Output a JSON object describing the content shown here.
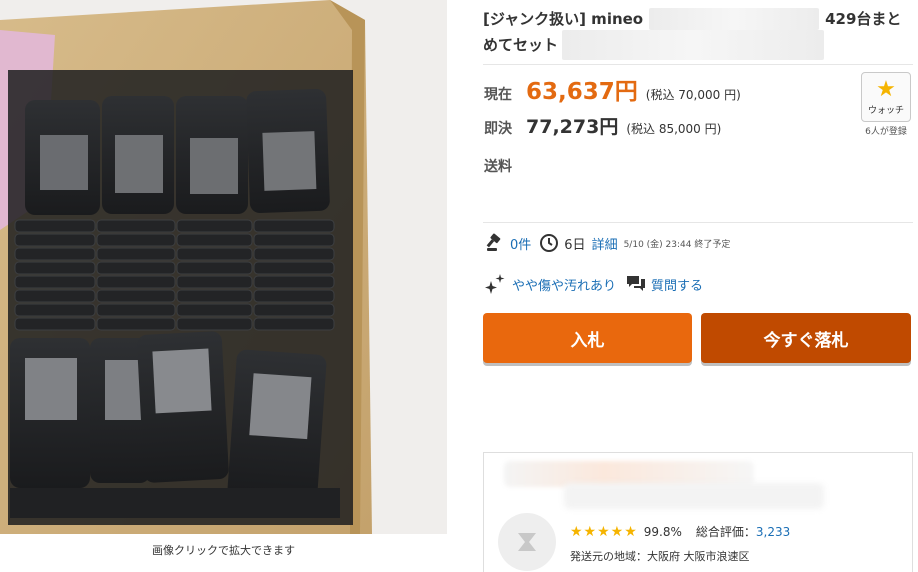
{
  "image": {
    "caption": "画像クリックで拡大できます"
  },
  "title": {
    "line1_prefix": "[ジャンク扱い] mineo",
    "line1_suffix": "429台まと",
    "line2": "めてセット"
  },
  "price": {
    "current_label": "現在",
    "current_value": "63,637円",
    "current_tax": "(税込 70,000 円)",
    "buynow_label": "即決",
    "buynow_value": "77,273円",
    "buynow_tax": "(税込 85,000 円)"
  },
  "shipping_label": "送料",
  "watch": {
    "label": "ウォッチ",
    "count": "6人が登録",
    "icon": "star-icon"
  },
  "meta": {
    "bids": "0件",
    "time_left": "6日",
    "detail_link": "詳細",
    "end_time": "5/10 (金) 23:44 終了予定",
    "condition": "やや傷や汚れあり",
    "question": "質問する"
  },
  "buttons": {
    "bid": "入札",
    "buy_now": "今すぐ落札"
  },
  "seller": {
    "positive_rate": "99.8%",
    "rating_label": "総合評価：",
    "rating_value": "3,233",
    "location": "発送元の地域：大阪府 大阪市浪速区"
  },
  "colors": {
    "accent": "#e36a11",
    "bid_button": "#e9680d",
    "buy_button": "#c04a00",
    "link": "#1a6eb5",
    "star": "#f5b400"
  }
}
